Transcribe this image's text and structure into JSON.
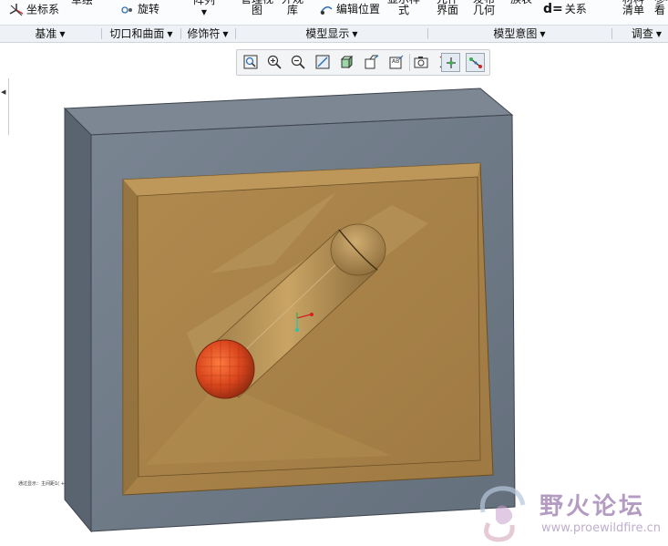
{
  "ribbon": {
    "coordinate_system": "坐标系",
    "sketch": "草绘",
    "revolve": "旋转",
    "pattern": "阵列",
    "manage_views": "管理视\n图",
    "appearance_library": "外观\n库",
    "edit_position": "编辑位置",
    "display_style": "显示样\n式",
    "component_interface": "元件\n界面",
    "publish_geometry": "发布\n几何",
    "tables": "族表",
    "relations": "关系",
    "bill_of_materials": "材料\n清单",
    "reference_viewer": "参考\n看"
  },
  "groups": {
    "datum": "基准",
    "cut_surface": "切口和曲面",
    "modifiers": "修饰符",
    "model_display": "模型显示",
    "model_intent": "模型意图",
    "investigate": "调查"
  },
  "view_toolbar": [
    {
      "name": "refit",
      "icon": "zoom-refit-icon"
    },
    {
      "name": "zoom_in",
      "icon": "zoom-in-icon"
    },
    {
      "name": "zoom_out",
      "icon": "zoom-out-icon"
    },
    {
      "name": "repaint",
      "icon": "repaint-icon"
    },
    {
      "name": "display_style",
      "icon": "display-style-icon"
    },
    {
      "name": "saved_orientations",
      "icon": "saved-orientations-icon"
    },
    {
      "name": "view_manager",
      "icon": "view-manager-icon"
    },
    {
      "name": "datum_display",
      "icon": "datum-display-filters-icon"
    },
    {
      "name": "spin_center",
      "icon": "spin-center-icon",
      "active": true
    },
    {
      "name": "annotation_display",
      "icon": "annotation-display-icon",
      "active": true
    }
  ],
  "status_text": "通过显示：主间距1(  +",
  "watermark": {
    "title": "野火论坛",
    "url": "www.proewildfire.cn"
  },
  "colors": {
    "frame_front": "#6d7886",
    "frame_side": "#4f5966",
    "cavity": "#a88246",
    "core": "#ad894c",
    "ball": "#d8451c",
    "accent": "#2f6fb3"
  }
}
